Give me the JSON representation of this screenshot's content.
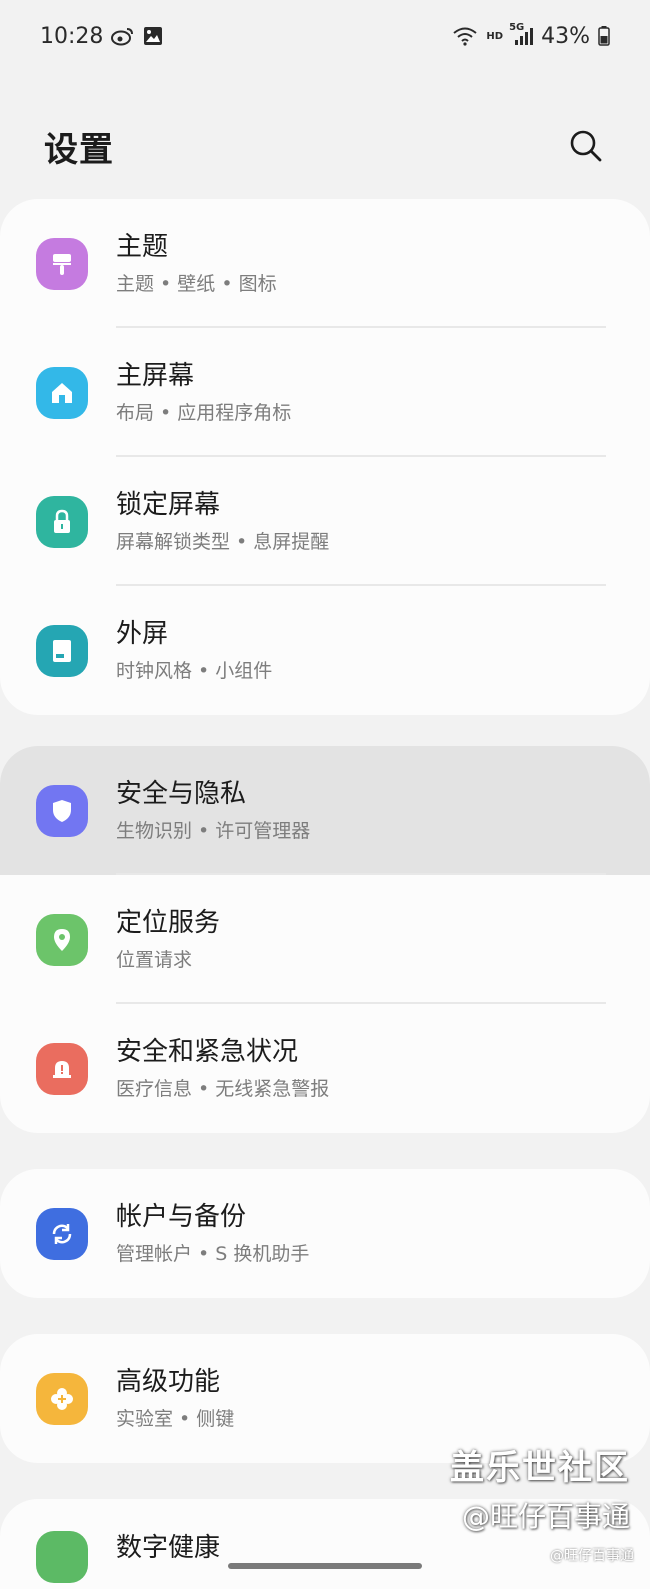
{
  "status_bar": {
    "time": "10:28",
    "left_icons": [
      "weibo-icon",
      "gallery-icon"
    ],
    "wifi_label": "HD",
    "network_label": "5G",
    "battery_percent": "43%"
  },
  "header": {
    "title": "设置",
    "search_icon": "search-icon"
  },
  "groups": [
    {
      "items": [
        {
          "title": "主题",
          "subtitle": "主题 • 壁纸 • 图标",
          "icon": "theme-brush-icon",
          "color": "#c57be0"
        },
        {
          "title": "主屏幕",
          "subtitle": "布局 • 应用程序角标",
          "icon": "home-icon",
          "color": "#33b8e8"
        },
        {
          "title": "锁定屏幕",
          "subtitle": "屏幕解锁类型 • 息屏提醒",
          "icon": "lock-icon",
          "color": "#2fb59f"
        },
        {
          "title": "外屏",
          "subtitle": "时钟风格 • 小组件",
          "icon": "cover-screen-icon",
          "color": "#25a6b3"
        }
      ]
    },
    {
      "items": [
        {
          "title": "安全与隐私",
          "subtitle": "生物识别 • 许可管理器",
          "icon": "shield-icon",
          "color": "#7276f2",
          "highlighted": true
        },
        {
          "title": "定位服务",
          "subtitle": "位置请求",
          "icon": "location-pin-icon",
          "color": "#6cc46a"
        },
        {
          "title": "安全和紧急状况",
          "subtitle": "医疗信息 • 无线紧急警报",
          "icon": "emergency-alert-icon",
          "color": "#ea6d5f"
        }
      ]
    },
    {
      "items": [
        {
          "title": "帐户与备份",
          "subtitle": "管理帐户 • S 换机助手",
          "icon": "sync-icon",
          "color": "#3f6ee0"
        }
      ]
    },
    {
      "items": [
        {
          "title": "高级功能",
          "subtitle": "实验室 • 侧键",
          "icon": "advanced-features-icon",
          "color": "#f5b63c"
        }
      ]
    },
    {
      "items": [
        {
          "title": "数字健康",
          "subtitle": "",
          "icon": "digital-wellbeing-icon",
          "color": "#5cba65"
        }
      ]
    }
  ],
  "watermark": {
    "main": "盖乐世社区",
    "handle": "@旺仔百事通",
    "small": "@旺仔百事通"
  }
}
